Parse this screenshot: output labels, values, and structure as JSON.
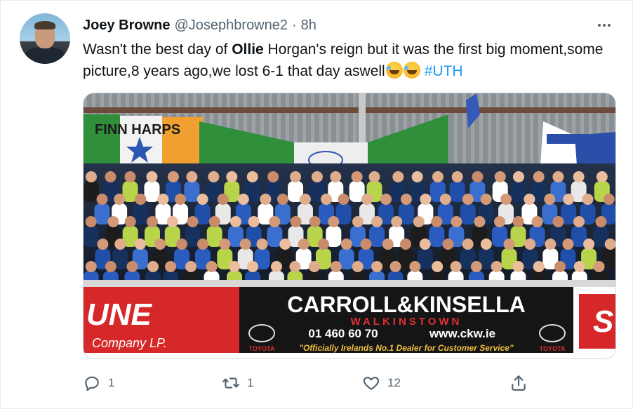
{
  "tweet": {
    "author_name": "Joey Browne",
    "author_handle": "@Josephbrowne2",
    "separator": "·",
    "time": "8h",
    "text_part1": "Wasn't the best day of ",
    "text_bold": "Ollie",
    "text_part2": " Horgan's reign but it was the first big moment,some picture,8 years ago,we lost 6-1 that day aswell",
    "emojis": [
      "rolling-on-floor-laughing-emoji",
      "rolling-on-floor-laughing-emoji"
    ],
    "hashtag": "#UTH"
  },
  "media": {
    "banner_flag_text": "FINN HARPS",
    "hoarding_left_text": "UNE",
    "hoarding_left_sub": "Company LP.",
    "hoarding_main_title": "CARROLL&KINSELLA",
    "hoarding_main_sub": "WALKINSTOWN",
    "hoarding_phone": "01 460 60 70",
    "hoarding_web": "www.ckw.ie",
    "hoarding_tagline": "\"Officially Irelands No.1 Dealer for Customer Service\"",
    "toyota_label": "TOYOTA",
    "hoarding_right_text": "S"
  },
  "actions": {
    "reply_count": "1",
    "retweet_count": "1",
    "like_count": "12"
  },
  "icons": {
    "more": "more-horizontal-icon",
    "reply": "reply-icon",
    "retweet": "retweet-icon",
    "like": "heart-icon",
    "share": "share-icon"
  },
  "colors": {
    "text": "#0f1419",
    "secondary": "#536471",
    "link": "#1d9bf0",
    "border": "#e6ecf0"
  }
}
